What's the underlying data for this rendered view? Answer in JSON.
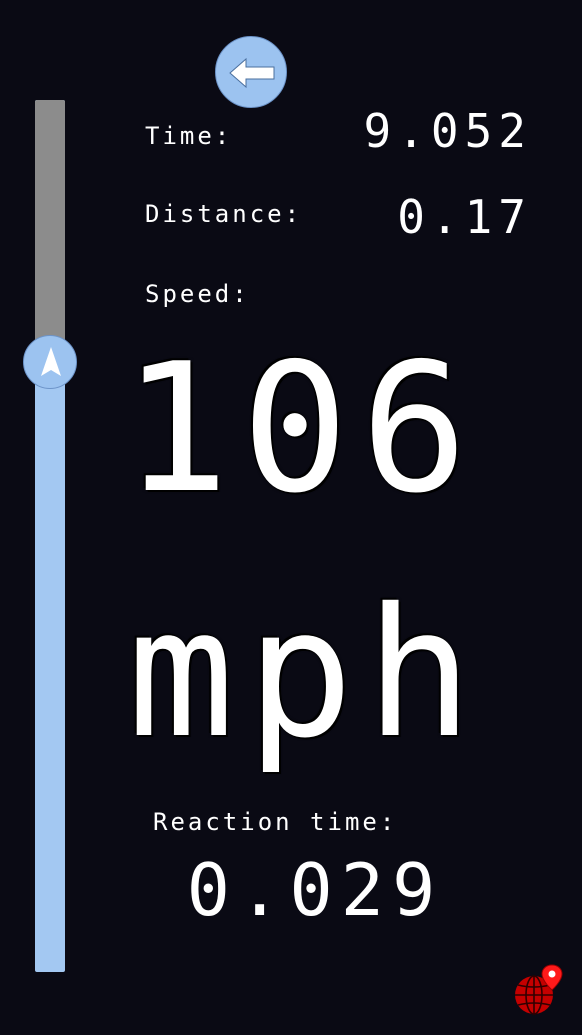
{
  "back_button": {
    "icon": "arrow-left-icon"
  },
  "slider": {
    "value_fraction": 0.7,
    "thumb_icon": "navigation-arrow-icon"
  },
  "stats": {
    "time_label": "Time:",
    "time_value": "9.052",
    "distance_label": "Distance:",
    "distance_value": "0.17",
    "speed_label": "Speed:",
    "speed_value": "106",
    "speed_unit": "mph",
    "reaction_label": "Reaction time:",
    "reaction_value": "0.029"
  },
  "map_button": {
    "icon": "globe-pin-icon"
  },
  "colors": {
    "background": "#0a0a14",
    "accent": "#9cc3f0",
    "track_fill": "#a3c8f2",
    "track_empty": "#8c8c8c",
    "map_icon": "#c40000"
  }
}
